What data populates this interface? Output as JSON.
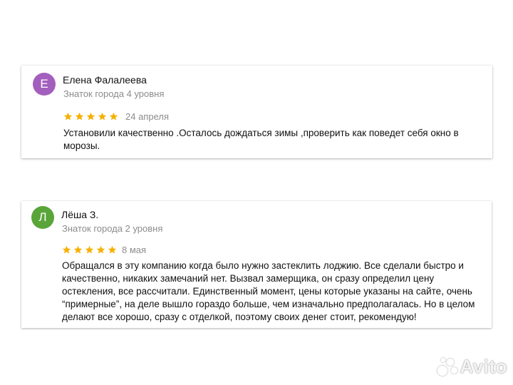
{
  "colors": {
    "star": "#f5b100",
    "avatar_1": "#a35fbd",
    "avatar_2": "#59a53a",
    "secondary_text": "#8c8c8c"
  },
  "reviews": [
    {
      "avatar_letter": "Е",
      "author": "Елена Фалалеева",
      "level": "Знаток города 4 уровня",
      "rating": 5,
      "date": "24 апреля",
      "text": "Установили качественно .Осталось дождаться зимы ,проверить как поведет себя окно в морозы."
    },
    {
      "avatar_letter": "Л",
      "author": "Лёша З.",
      "level": "Знаток города 2 уровня",
      "rating": 5,
      "date": "8 мая",
      "text": "Обращался в эту компанию когда было нужно застеклить лоджию. Все сделали быстро и качественно, никаких замечаний нет. Вызвал замерщика, он сразу определил цену остекления, все рассчитали. Единственный момент, цены которые указаны на сайте, очень “примерные”, на деле вышло гораздо больше, чем изначально предполагалась. Но в целом делают все хорошо, сразу с отделкой, поэтому своих денег стоит, рекомендую!"
    }
  ],
  "watermark": {
    "text": "Avito",
    "icon": "avito-logo-icon"
  }
}
